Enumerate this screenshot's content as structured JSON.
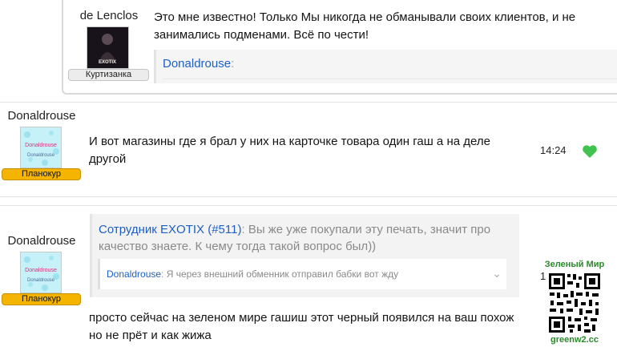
{
  "posts": [
    {
      "user": "de Lenclos",
      "avatar_text": "EXOTIX",
      "rank": "Куртизанка",
      "message": "Это мне известно! Только Мы никогда не обманывали своих клиентов, и не занимались подменами. Всё по чести!",
      "quote": {
        "author": "Donaldrouse",
        "separator": ":"
      }
    },
    {
      "user": "Donaldrouse",
      "avatar_text": "Donaldrouse",
      "rank": "Планокур",
      "message": "И вот магазины где я брал у них на карточке товара один гаш а на деле другой",
      "time": "14:24"
    },
    {
      "user": "Donaldrouse",
      "avatar_text": "Donaldrouse",
      "rank": "Планокур",
      "quote": {
        "author": "Сотрудник EXOTIX (#511)",
        "separator": ":",
        "text": "Вы же уже покупали эту печать, значит про качество знаете. К чему тогда такой вопрос был))",
        "inner_author": "Donaldrouse",
        "inner_separator": ":",
        "inner_text": "Я через внешний обменник отправил бабки вот жду"
      },
      "message": "просто сейчас на зеленом мире гашиш этот черный появился на ваш похож но не прёт и как жижа",
      "time_partial": "1"
    }
  ],
  "ad": {
    "title": "Зеленый Мир",
    "footer": "greenw2.cc"
  },
  "colors": {
    "link": "#1e5fc6",
    "rank_gold": "#f4b400",
    "like": "#3fc24e",
    "ad_green": "#2b8a2b"
  },
  "icons": {
    "like": "heart-icon",
    "expand": "chevron-down-icon"
  }
}
